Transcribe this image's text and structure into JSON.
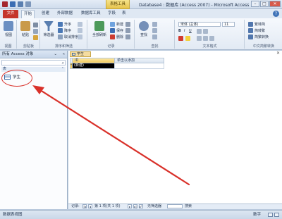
{
  "window": {
    "title": "Database4 : 数据库 (Access 2007) - Microsoft Access",
    "context_tab": "表格工具",
    "controls": [
      "–",
      "□",
      "✕"
    ]
  },
  "quick_access": [
    "app-icon",
    "save-icon",
    "undo-icon",
    "redo-icon"
  ],
  "tabs": [
    {
      "label": "文件"
    },
    {
      "label": "开始"
    },
    {
      "label": "创建"
    },
    {
      "label": "外部数据"
    },
    {
      "label": "数据库工具"
    },
    {
      "label": "字段"
    },
    {
      "label": "表"
    }
  ],
  "ribbon": {
    "view": {
      "label": "视图",
      "group": "视图"
    },
    "clipboard": {
      "paste": "粘贴",
      "group": "剪贴板"
    },
    "sort_filter": {
      "filter": "筛选器",
      "asc": "升序",
      "desc": "降序",
      "remove": "取消排序",
      "group": "排序和筛选"
    },
    "records": {
      "refresh": "全部刷新",
      "new": "新建",
      "save": "保存",
      "delete": "删除",
      "group": "记录"
    },
    "find": {
      "find": "查找",
      "group": "查找"
    },
    "text_format": {
      "font": "宋体 (主体)",
      "size": "11",
      "group": "文本格式"
    },
    "chinese": {
      "item1": "繁转简",
      "item2": "简转繁",
      "item3": "简繁转换",
      "group": "中文简繁转换"
    }
  },
  "nav_pane": {
    "header": "所有 Access 对象",
    "group": "表",
    "items": [
      {
        "label": "学生"
      }
    ]
  },
  "document": {
    "tab": "学生",
    "columns": [
      "ID",
      "单击以添加"
    ],
    "new_row": "(新建)",
    "new_marker": "*"
  },
  "record_nav": {
    "label": "记录:",
    "position": "第 1 项(共 1 项)",
    "filter": "无筛选器",
    "search": "搜索"
  },
  "status": {
    "left": "数据表视图",
    "right": "数字"
  },
  "colors": {
    "file_tab": "#c5352b",
    "annotation": "#d9312a"
  }
}
